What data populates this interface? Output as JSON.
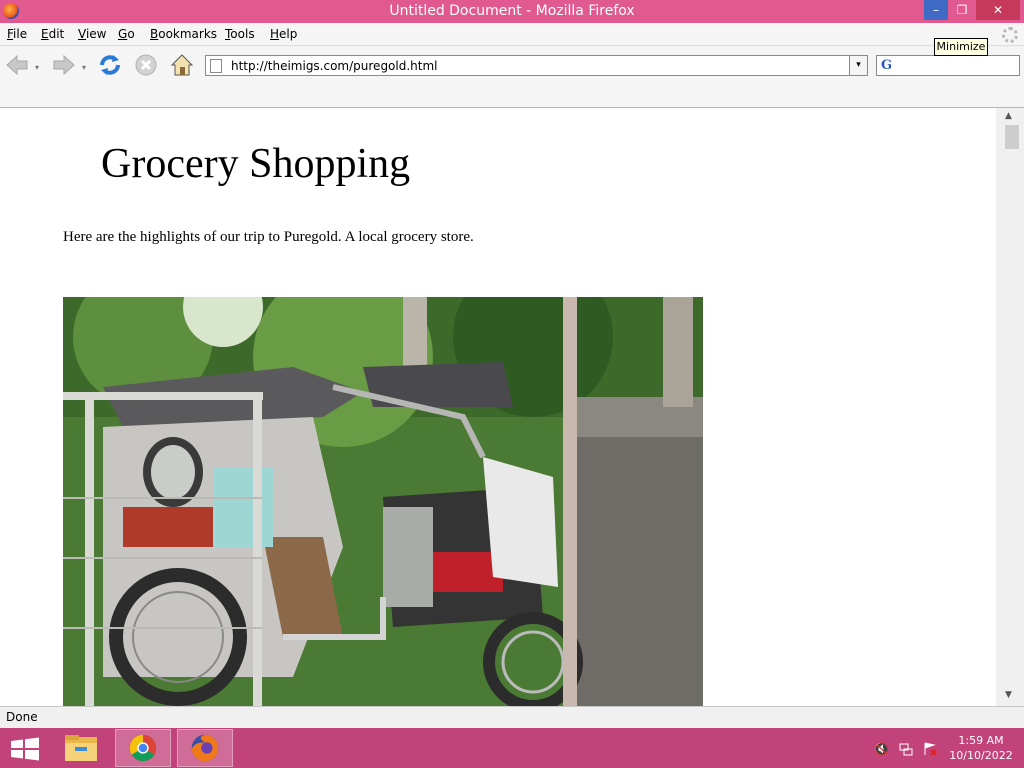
{
  "window": {
    "title": "Untitled Document - Mozilla Firefox",
    "min_glyph": "–",
    "max_glyph": "❐",
    "close_glyph": "✕",
    "tooltip": "Minimize"
  },
  "menu": {
    "items": [
      {
        "label": "File",
        "key": "F",
        "rest": "ile"
      },
      {
        "label": "Edit",
        "key": "E",
        "rest": "dit"
      },
      {
        "label": "View",
        "key": "V",
        "rest": "iew"
      },
      {
        "label": "Go",
        "key": "G",
        "rest": "o"
      },
      {
        "label": "Bookmarks",
        "key": "B",
        "rest": "ookmarks"
      },
      {
        "label": "Tools",
        "key": "T",
        "rest": "ools"
      },
      {
        "label": "Help",
        "key": "H",
        "rest": "elp"
      }
    ]
  },
  "toolbar": {
    "url": "http://theimigs.com/puregold.html",
    "dropdown_glyph": "▾",
    "search_logo": "G"
  },
  "page": {
    "title": "Grocery Shopping",
    "intro": "Here are the highlights of our trip to Puregold. A local grocery store."
  },
  "scroll": {
    "up": "▲",
    "down": "▼"
  },
  "status": {
    "text": "Done"
  },
  "taskbar": {
    "time": "1:59 AM",
    "date": "10/10/2022"
  },
  "icons": [
    "firefox-icon",
    "back-icon",
    "forward-icon",
    "reload-icon",
    "stop-icon",
    "home-icon",
    "page-icon",
    "google-search-icon",
    "windows-start-icon",
    "file-explorer-icon",
    "chrome-icon",
    "speaker-muted-icon",
    "network-icon",
    "action-center-icon"
  ]
}
